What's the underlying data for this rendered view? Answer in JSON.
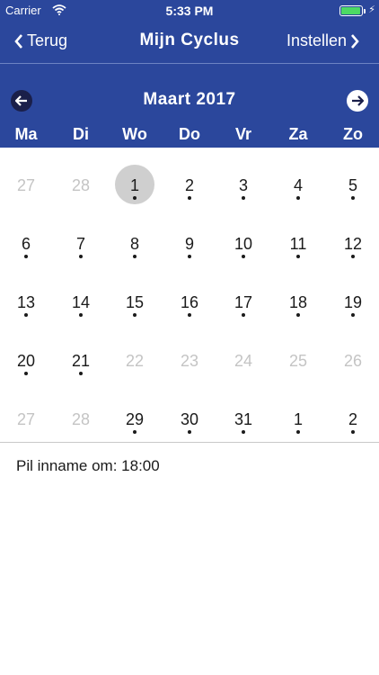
{
  "status": {
    "carrier": "Carrier",
    "time": "5:33 PM",
    "battery_level": 0.95
  },
  "nav": {
    "back_label": "Terug",
    "title": "Mijn Cyclus",
    "settings_label": "Instellen"
  },
  "calendar": {
    "month_label": "Maart 2017",
    "weekdays": [
      "Ma",
      "Di",
      "Wo",
      "Do",
      "Vr",
      "Za",
      "Zo"
    ],
    "weeks": [
      [
        {
          "d": "27",
          "muted": true,
          "dot": false
        },
        {
          "d": "28",
          "muted": true,
          "dot": false
        },
        {
          "d": "1",
          "muted": false,
          "dot": true,
          "today": true
        },
        {
          "d": "2",
          "muted": false,
          "dot": true
        },
        {
          "d": "3",
          "muted": false,
          "dot": true
        },
        {
          "d": "4",
          "muted": false,
          "dot": true
        },
        {
          "d": "5",
          "muted": false,
          "dot": true
        }
      ],
      [
        {
          "d": "6",
          "muted": false,
          "dot": true
        },
        {
          "d": "7",
          "muted": false,
          "dot": true
        },
        {
          "d": "8",
          "muted": false,
          "dot": true
        },
        {
          "d": "9",
          "muted": false,
          "dot": true
        },
        {
          "d": "10",
          "muted": false,
          "dot": true
        },
        {
          "d": "11",
          "muted": false,
          "dot": true
        },
        {
          "d": "12",
          "muted": false,
          "dot": true
        }
      ],
      [
        {
          "d": "13",
          "muted": false,
          "dot": true
        },
        {
          "d": "14",
          "muted": false,
          "dot": true
        },
        {
          "d": "15",
          "muted": false,
          "dot": true
        },
        {
          "d": "16",
          "muted": false,
          "dot": true
        },
        {
          "d": "17",
          "muted": false,
          "dot": true
        },
        {
          "d": "18",
          "muted": false,
          "dot": true
        },
        {
          "d": "19",
          "muted": false,
          "dot": true
        }
      ],
      [
        {
          "d": "20",
          "muted": false,
          "dot": true
        },
        {
          "d": "21",
          "muted": false,
          "dot": true
        },
        {
          "d": "22",
          "muted": true,
          "dot": false
        },
        {
          "d": "23",
          "muted": true,
          "dot": false
        },
        {
          "d": "24",
          "muted": true,
          "dot": false
        },
        {
          "d": "25",
          "muted": true,
          "dot": false
        },
        {
          "d": "26",
          "muted": true,
          "dot": false
        }
      ],
      [
        {
          "d": "27",
          "muted": true,
          "dot": false
        },
        {
          "d": "28",
          "muted": true,
          "dot": false
        },
        {
          "d": "29",
          "muted": false,
          "dot": true
        },
        {
          "d": "30",
          "muted": false,
          "dot": true
        },
        {
          "d": "31",
          "muted": false,
          "dot": true
        },
        {
          "d": "1",
          "muted": false,
          "dot": true
        },
        {
          "d": "2",
          "muted": false,
          "dot": true
        }
      ]
    ]
  },
  "pill": {
    "text": "Pil inname om: 18:00"
  },
  "colors": {
    "header_blue": "#2b479c",
    "today_circle": "#cfcfcf",
    "muted_text": "#c4c4c4"
  }
}
